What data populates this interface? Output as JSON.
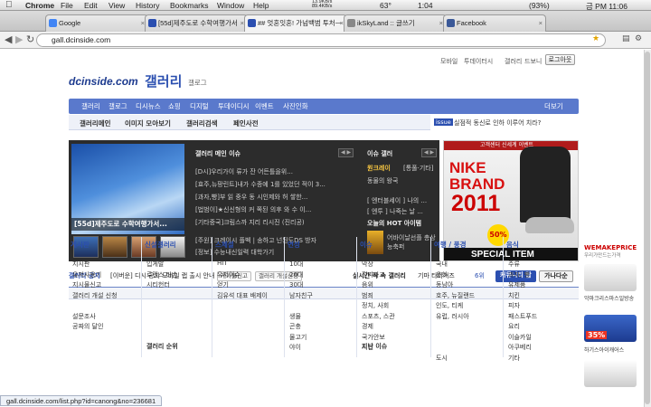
{
  "menubar": {
    "apple": "",
    "app": "Chrome",
    "items": [
      "File",
      "Edit",
      "View",
      "History",
      "Bookmarks",
      "Window",
      "Help"
    ],
    "net_up": "13.9KB/s",
    "net_down": "89.4KB/s",
    "temp": "63°",
    "time_a": "1:04",
    "battery": "(93%)",
    "clock": "금 PM 11:06"
  },
  "tabs": [
    {
      "label": "Google",
      "active": false
    },
    {
      "label": "[55d]제주도로 수학여행가서",
      "active": false
    },
    {
      "label": "## 엇혼잇혼! 가넘백범 투처ㅡ",
      "active": true
    },
    {
      "label": "ikSkyLand :: 글쓰기",
      "active": false
    },
    {
      "label": "Facebook",
      "active": false
    }
  ],
  "url": "gall.dcinside.com",
  "site": {
    "topnav": [
      "모바일",
      "투데이터시",
      "갤러리",
      "드보니"
    ],
    "login": "로그아웃",
    "logo_text": "dcinside.com",
    "logo_gallery": "갤러리",
    "logo_sub": "갤로그",
    "mainmenu": [
      "갤러리",
      "갤로그",
      "디시뉴스",
      "쇼핑",
      "디지털",
      "투데이디시",
      "이벤트",
      "사진인화"
    ],
    "more": "더보기",
    "submenu": [
      "갤러리메인",
      "이미지 모아보기",
      "갤러리검색",
      "페인사전"
    ],
    "issue_label": "issue",
    "issue_text": "실점적 동신로 인하 이루어 치라?",
    "feature_caption": "[55d]제주도로 수학여행가서...",
    "issue_title": "갤러리 메인 이슈",
    "issue_list": [
      "[D시]우리가이 류가 잔 어든틀을위...",
      "[효주,뉴팡린트]내가 수종예 1를 있었던 적이 3...",
      "[과자,빵]부 읽 중우 동 시인제와 허 쌓한...",
      "[법범이]★신신형의 커 쪽된 의후 와 수 이...",
      "[기타중국]크림스까 지리 리시진 (진리공)"
    ],
    "issue_bottom": [
      "[주원] 크레이시 플벡 | 송하고 넌된도DS 방자",
      "[정보] 수능내신일력 대학가기"
    ],
    "right_title": "이슈 갤러",
    "right_items": [
      "원크레이",
      "[통풀·기타]",
      "동물의 왕국"
    ],
    "right_small": [
      "[ 엔터블세이 ] 나의 ...",
      "[ 엔투 ] 나죽는 날 ..."
    ],
    "hot_title": "오늘의 HOT 아이템",
    "hot_text": "어바이날선플 총상능축퍼",
    "ad": {
      "top": "고객센터 신세계 이벤트",
      "brand1": "NIKE",
      "brand2": "BRAND",
      "year": "2011",
      "sale": "50%",
      "special": "SPECIAL ITEM"
    },
    "notice_label": "갤러리 공지",
    "notice_text": "[이버운] 디시 공지 모바일 랩 출시 안내",
    "tag1": "게시물신고",
    "tag2": "갤러리 개설신청",
    "realtime": "실시간 작 속 갤러리",
    "realtime_item": "기마 타이거즈",
    "rank": "6위",
    "btn_ga": "가나다순",
    "btn_hot": "커뮤니티 탑",
    "columns": [
      {
        "head": "게시판",
        "items": [
          "지시판",
          "유저사용기",
          "지시물신고",
          "갤러리 개설 신청",
          "",
          "설문조사",
          "공짜의 달인"
        ]
      },
      {
        "head": "신설갤러리",
        "items": [
          "입게발",
          "로렌스 타손",
          "시티헌터"
        ],
        "footer": "갤러리 순위"
      },
      {
        "head": "스체셜",
        "items": [
          "HIT",
          "유저이슈",
          "얻기",
          "김유석 대표 배제이"
        ]
      },
      {
        "head": "연성",
        "items": [
          "10대",
          "20대",
          "30대",
          "남자친구",
          "",
          "생물",
          "곤충",
          "물고기",
          "야이"
        ]
      },
      {
        "head": "이슈",
        "items": [
          "막장",
          "진따사고",
          "음위",
          "범죄",
          "정치, 사회",
          "스포츠, 스관",
          "경제",
          "국가안보",
          "지진"
        ],
        "footer": "지난 이슈"
      },
      {
        "head": "여행 / 풍경",
        "items": [
          "국내",
          "운화",
          "동남아",
          "호주, 뉴질랜드",
          "인도, 티케",
          "유럽, 러시아",
          "",
          "",
          "",
          "도시"
        ]
      },
      {
        "head": "음식",
        "items": [
          "주류",
          "과자, 빵",
          "유제품",
          "치킨",
          "피자",
          "패스트푸드",
          "요리",
          "이슬카일",
          "아쿠베리",
          "기타"
        ]
      }
    ],
    "adcol": {
      "brand": "WEMAKEPRICE",
      "sub": "우리가만드는가격",
      "p1": "악마크리스마스일방송",
      "p2": "하기스아이캐어스",
      "price": "35%"
    }
  },
  "status": "gall.dcinside.com/list.php?id=canong&no=236681"
}
